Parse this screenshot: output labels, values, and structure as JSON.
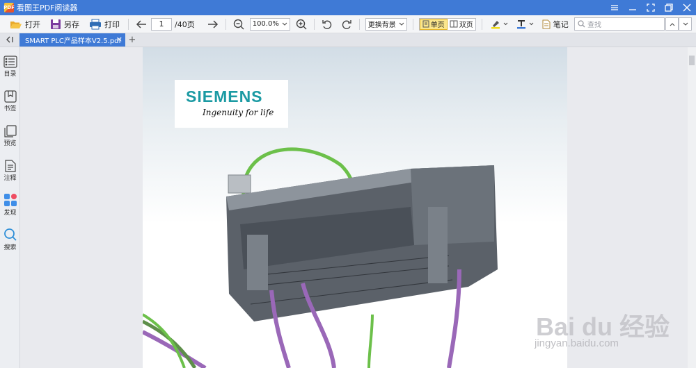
{
  "window": {
    "title": "看图王PDF阅读器",
    "logo_text": "PDF"
  },
  "toolbar": {
    "open_label": "打开",
    "save_as_label": "另存",
    "print_label": "打印",
    "current_page": "1",
    "total_pages": "/40页",
    "zoom_value": "100.0%",
    "background_label": "更换背景",
    "single_page_label": "单页",
    "double_page_label": "双页",
    "note_label": "笔记",
    "search_placeholder": "查找"
  },
  "tabs": [
    {
      "label": "SMART PLC产品样本V2.5.pdf",
      "active": true
    }
  ],
  "sidebar": {
    "items": [
      {
        "label": "目录",
        "icon": "list-icon"
      },
      {
        "label": "书签",
        "icon": "bookmark-icon"
      },
      {
        "label": "预览",
        "icon": "preview-icon"
      },
      {
        "label": "注释",
        "icon": "annotation-icon"
      },
      {
        "label": "发现",
        "icon": "discover-icon"
      },
      {
        "label": "搜索",
        "icon": "search-icon"
      }
    ]
  },
  "document": {
    "logo_brand": "SIEMENS",
    "logo_tagline": "Ingenuity for life"
  },
  "watermark": {
    "brand": "Bai du 经验",
    "url": "jingyan.baidu.com"
  },
  "colors": {
    "titlebar": "#3f7ad6",
    "siemens_teal": "#1b9aa3",
    "active_view": "#fbe68c"
  }
}
